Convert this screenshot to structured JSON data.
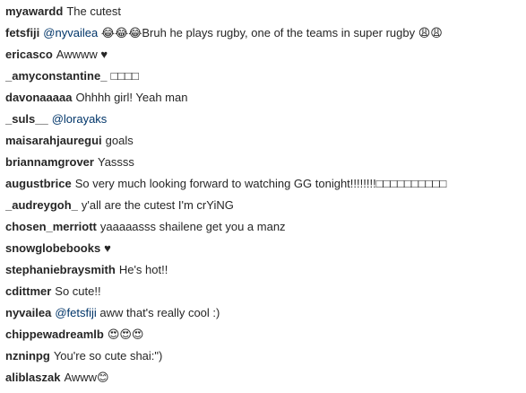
{
  "comments": [
    {
      "username": "myawardd",
      "parts": [
        {
          "type": "text",
          "value": "The cutest"
        }
      ]
    },
    {
      "username": "fetsfiji",
      "parts": [
        {
          "type": "mention",
          "value": "@nyvailea"
        },
        {
          "type": "text",
          "value": " 😂😂😂Bruh he plays rugby, one of the teams in super rugby 😩😩"
        }
      ]
    },
    {
      "username": "ericasco",
      "parts": [
        {
          "type": "text",
          "value": "Awwww ♥"
        }
      ]
    },
    {
      "username": "_amyconstantine_",
      "parts": [
        {
          "type": "text",
          "value": "□□□□"
        }
      ]
    },
    {
      "username": "davonaaaaa",
      "parts": [
        {
          "type": "text",
          "value": "Ohhhh girl! Yeah man"
        }
      ]
    },
    {
      "username": "_suls__",
      "parts": [
        {
          "type": "mention",
          "value": "@lorayaks"
        }
      ]
    },
    {
      "username": "maisarahjauregui",
      "parts": [
        {
          "type": "text",
          "value": "goals"
        }
      ]
    },
    {
      "username": "briannamgrover",
      "parts": [
        {
          "type": "text",
          "value": "Yassss"
        }
      ]
    },
    {
      "username": "augustbrice",
      "parts": [
        {
          "type": "text",
          "value": "So very much looking forward to watching GG tonight!!!!!!!!□□□□□□□□□□"
        }
      ]
    },
    {
      "username": "_audreygoh_",
      "parts": [
        {
          "type": "text",
          "value": "y'all are the cutest I'm crYiNG"
        }
      ]
    },
    {
      "username": "chosen_merriott",
      "parts": [
        {
          "type": "text",
          "value": "yaaaaasss shailene get you a manz"
        }
      ]
    },
    {
      "username": "snowglobebooks",
      "parts": [
        {
          "type": "text",
          "value": "♥"
        }
      ]
    },
    {
      "username": "stephaniebraysmith",
      "parts": [
        {
          "type": "text",
          "value": "He's hot!!"
        }
      ]
    },
    {
      "username": "cdittmer",
      "parts": [
        {
          "type": "text",
          "value": "So cute!!"
        }
      ]
    },
    {
      "username": "nyvailea",
      "parts": [
        {
          "type": "mention",
          "value": "@fetsfiji"
        },
        {
          "type": "text",
          "value": " aww that's really cool :)"
        }
      ]
    },
    {
      "username": "chippewadreamlb",
      "parts": [
        {
          "type": "text",
          "value": "😍😍😍"
        }
      ]
    },
    {
      "username": "nzninpg",
      "parts": [
        {
          "type": "text",
          "value": "You're so cute shai:\")"
        }
      ]
    },
    {
      "username": "aliblaszak",
      "parts": [
        {
          "type": "text",
          "value": "Awww😊"
        }
      ]
    }
  ]
}
